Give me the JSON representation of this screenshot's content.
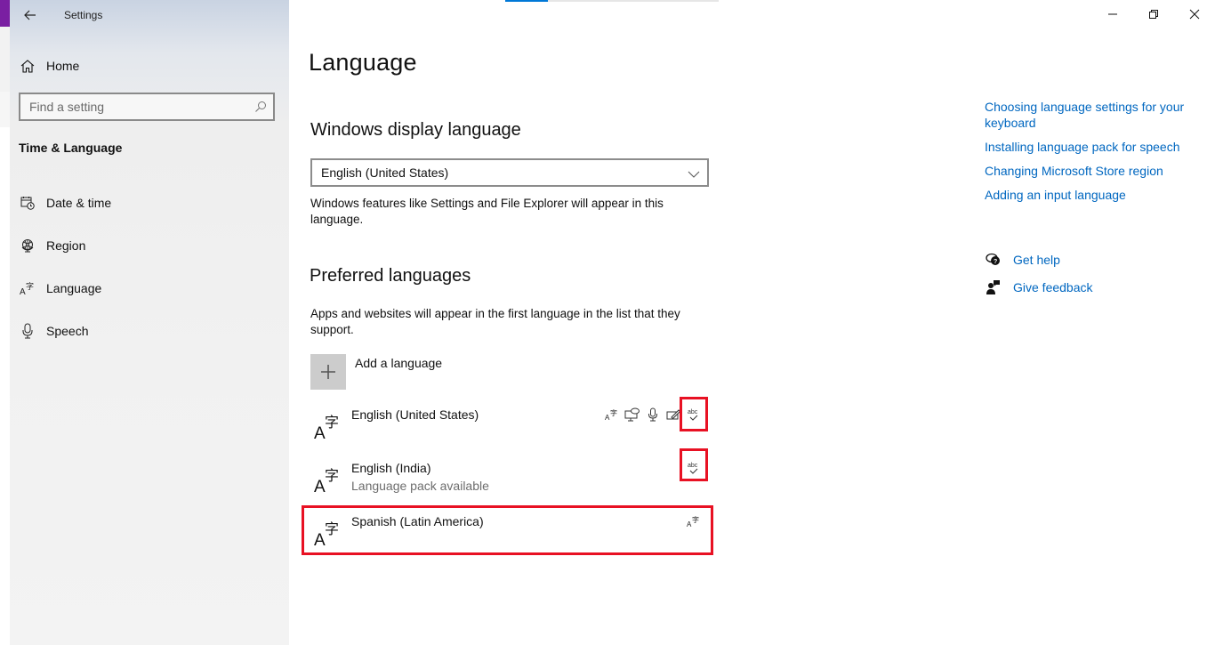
{
  "window": {
    "title": "Settings",
    "controls": {
      "minimize": "minimize",
      "maximize": "restore",
      "close": "close"
    },
    "progress_percent": 20
  },
  "sidebar": {
    "home_label": "Home",
    "search_placeholder": "Find a setting",
    "section_title": "Time & Language",
    "items": [
      {
        "label": "Date & time",
        "icon": "calendar-clock-icon"
      },
      {
        "label": "Region",
        "icon": "globe-icon"
      },
      {
        "label": "Language",
        "icon": "language-icon"
      },
      {
        "label": "Speech",
        "icon": "microphone-icon"
      }
    ]
  },
  "main": {
    "page_title": "Language",
    "display_language": {
      "heading": "Windows display language",
      "selected": "English (United States)",
      "description": "Windows features like Settings and File Explorer will appear in this language."
    },
    "preferred": {
      "heading": "Preferred languages",
      "description": "Apps and websites will appear in the first language in the list that they support.",
      "add_label": "Add a language",
      "languages": [
        {
          "name": "English (United States)",
          "sub": "",
          "features": [
            "display-language-icon",
            "text-to-speech-icon",
            "speech-recognition-icon",
            "handwriting-icon",
            "spell-check-icon"
          ],
          "highlighted_feature": "spell-check-icon"
        },
        {
          "name": "English (India)",
          "sub": "Language pack available",
          "features": [
            "spell-check-icon"
          ],
          "highlighted_feature": "spell-check-icon"
        },
        {
          "name": "Spanish (Latin America)",
          "sub": "",
          "features": [
            "display-language-icon"
          ],
          "highlighted_row": true
        }
      ]
    }
  },
  "related": {
    "links": [
      "Choosing language settings for your keyboard",
      "Installing language pack for speech",
      "Changing Microsoft Store region",
      "Adding an input language"
    ],
    "get_help": "Get help",
    "give_feedback": "Give feedback"
  },
  "colors": {
    "accent": "#0078d7",
    "link": "#0067c0",
    "highlight": "#e81123"
  }
}
